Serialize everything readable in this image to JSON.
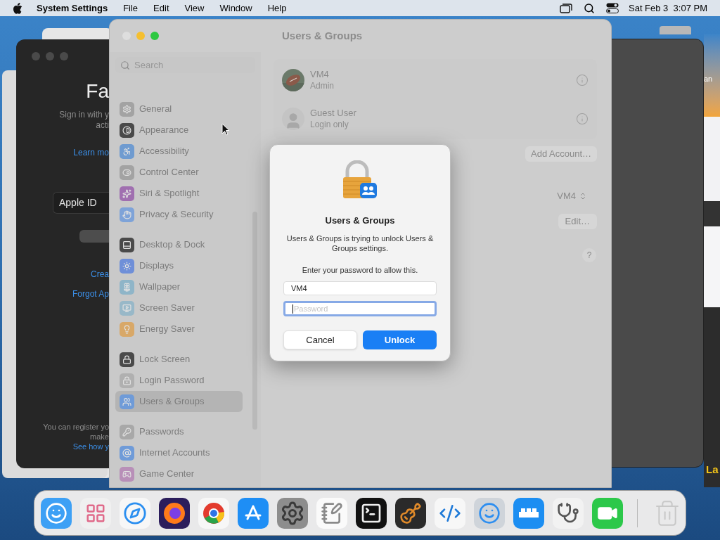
{
  "menu_bar": {
    "app_name": "System Settings",
    "menus": [
      "File",
      "Edit",
      "View",
      "Window",
      "Help"
    ],
    "clock": "Sat Feb 3  3:07 PM"
  },
  "left_window": {
    "title": "Fa",
    "subtitle_lines": [
      "Sign in with y",
      "acti"
    ],
    "link": "Learn mo",
    "field": "Apple ID",
    "links": [
      "Crea",
      "Forgot Ap"
    ],
    "footer_lines": [
      "You can register yo",
      "make"
    ],
    "footer_link": "See how y"
  },
  "right_edge": {
    "top_text": "an",
    "bottom_text": "La"
  },
  "settings": {
    "title": "Users & Groups",
    "search": {
      "placeholder": "Search"
    },
    "sidebar": {
      "groups": [
        {
          "items": [
            {
              "label": "General",
              "color": "#a3a3a3",
              "selected": false
            },
            {
              "label": "Appearance",
              "color": "#4a4a4a",
              "selected": false
            },
            {
              "label": "Accessibility",
              "color": "#6f9bd0",
              "selected": false
            },
            {
              "label": "Control Center",
              "color": "#a3a3a3",
              "selected": false
            },
            {
              "label": "Siri & Spotlight",
              "color": "#a06fb0",
              "selected": false
            },
            {
              "label": "Privacy & Security",
              "color": "#7ea3d8",
              "selected": false
            }
          ]
        },
        {
          "items": [
            {
              "label": "Desktop & Dock",
              "color": "#4a4a4a",
              "selected": false
            },
            {
              "label": "Displays",
              "color": "#6f8fd8",
              "selected": false
            },
            {
              "label": "Wallpaper",
              "color": "#8fb5c8",
              "selected": false
            },
            {
              "label": "Screen Saver",
              "color": "#98b8c8",
              "selected": false
            },
            {
              "label": "Energy Saver",
              "color": "#d8a868",
              "selected": false
            }
          ]
        },
        {
          "items": [
            {
              "label": "Lock Screen",
              "color": "#4a4a4a",
              "selected": false
            },
            {
              "label": "Login Password",
              "color": "#b0b0b0",
              "selected": false
            },
            {
              "label": "Users & Groups",
              "color": "#6f9bd8",
              "selected": true
            }
          ]
        },
        {
          "items": [
            {
              "label": "Passwords",
              "color": "#a8a8a8",
              "selected": false
            },
            {
              "label": "Internet Accounts",
              "color": "#6f9bd8",
              "selected": false
            },
            {
              "label": "Game Center",
              "color": "#b88fb8",
              "selected": false
            }
          ]
        }
      ]
    },
    "users": [
      {
        "name": "VM4",
        "role": "Admin"
      },
      {
        "name": "Guest User",
        "role": "Login only",
        "kind": "guest"
      }
    ],
    "add_button": "Add Account…",
    "popup": {
      "value": "VM4"
    },
    "edit_button": "Edit…",
    "help_button": "?"
  },
  "dialog": {
    "title": "Users & Groups",
    "message": "Users & Groups is trying to unlock Users & Groups settings.",
    "prompt": "Enter your password to allow this.",
    "username": {
      "value": "VM4"
    },
    "password": {
      "placeholder": "Password",
      "focused": true
    },
    "buttons": [
      {
        "label": "Cancel",
        "kind": "secondary"
      },
      {
        "label": "Unlock",
        "kind": "primary"
      }
    ]
  }
}
